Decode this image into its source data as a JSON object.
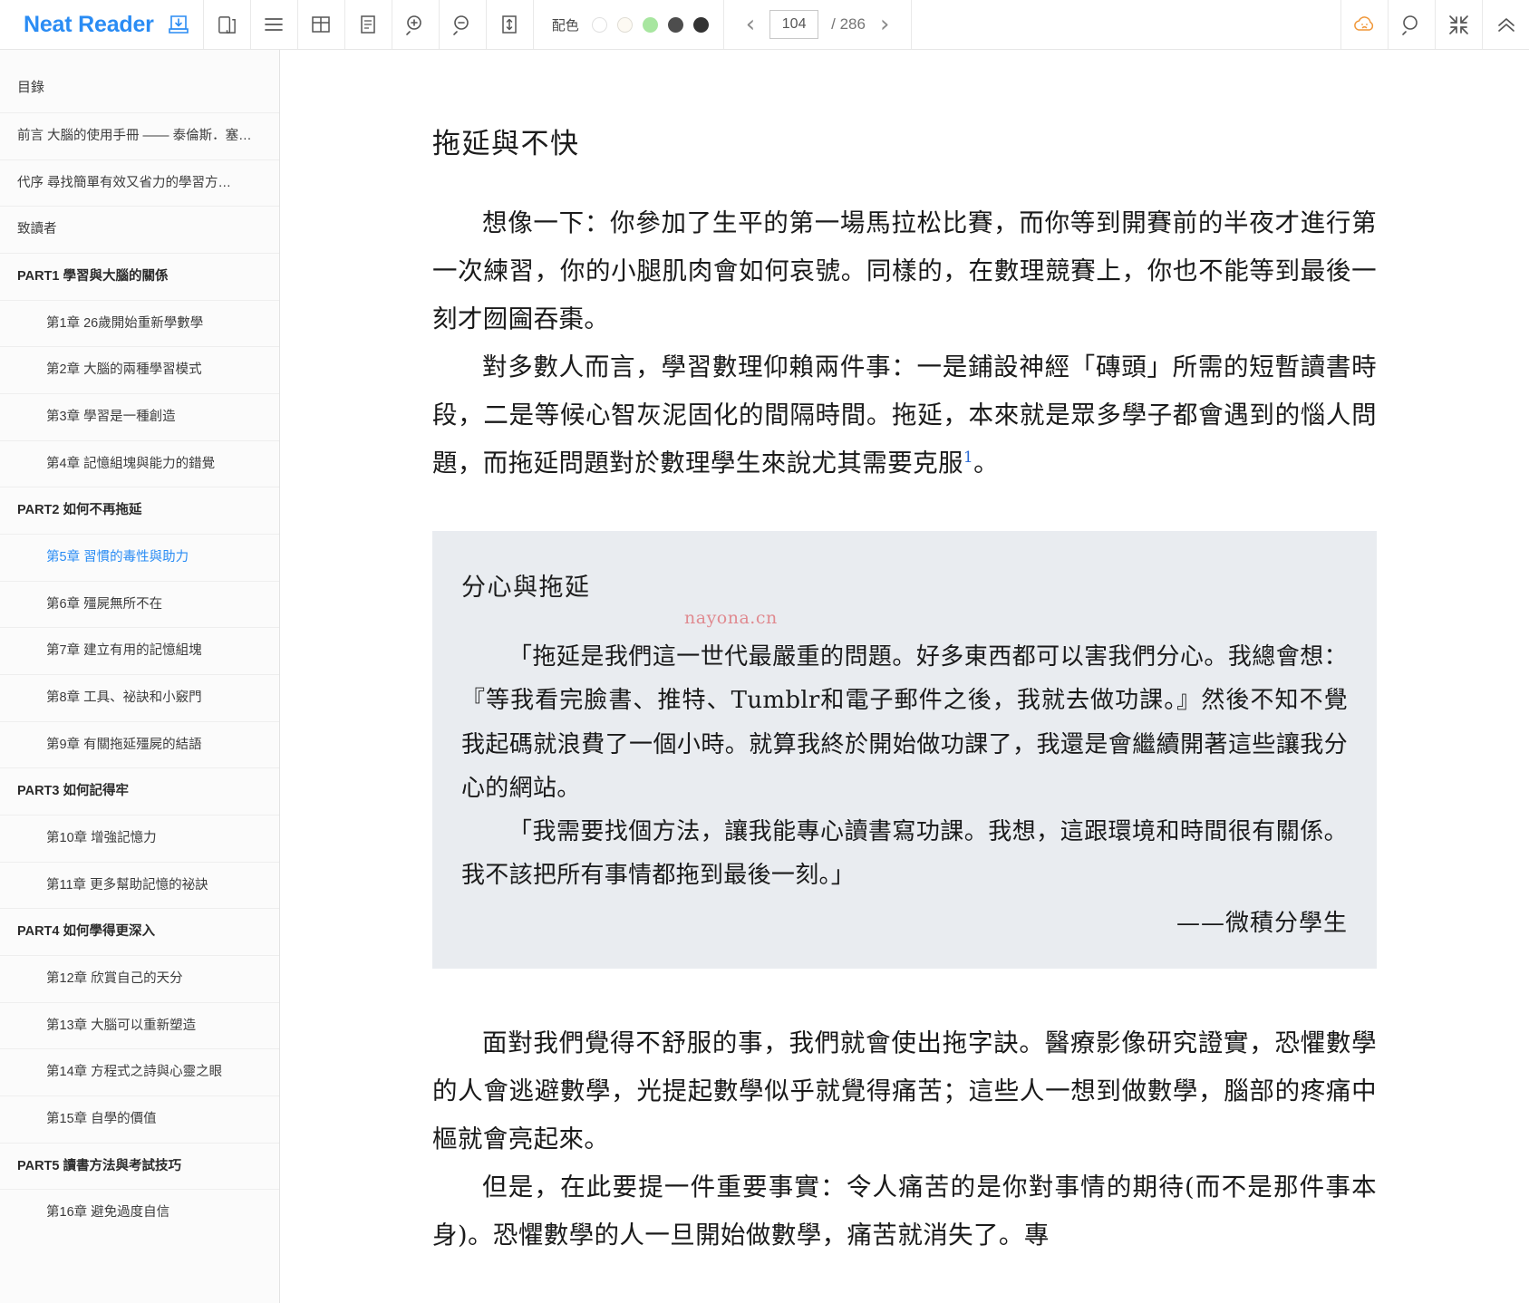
{
  "app": {
    "brand": "Neat Reader",
    "icons": {
      "logo_save": "book-save-icon",
      "copy": "copy-pages-icon",
      "list": "list-view-icon",
      "grid": "grid-view-icon",
      "single": "single-page-icon",
      "zoom_in": "zoom-in-icon",
      "zoom_out": "zoom-out-icon",
      "fit_height": "fit-height-icon",
      "cloud": "cloud-sync-icon",
      "search": "search-icon",
      "collapse": "collapse-icon",
      "chevron_up": "chevron-up-icon",
      "prev": "chevron-left-icon",
      "next": "chevron-right-icon"
    }
  },
  "toolbar": {
    "palette_label": "配色",
    "swatches": [
      {
        "name": "theme-white",
        "color": "#ffffff",
        "border": "#e0e0e0"
      },
      {
        "name": "theme-sepia",
        "color": "#fdfaf3",
        "border": "#e0ddd5"
      },
      {
        "name": "theme-green",
        "color": "#a8e6a0",
        "border": "#a8e6a0"
      },
      {
        "name": "theme-dark-gray",
        "color": "#4d4d4d",
        "border": "#4d4d4d"
      },
      {
        "name": "theme-black",
        "color": "#333333",
        "border": "#333333"
      }
    ],
    "pager": {
      "current": "104",
      "total": "/ 286",
      "prev_glyph": "‹",
      "next_glyph": "›"
    }
  },
  "sidebar": {
    "heading": "目錄",
    "items": [
      {
        "label": "前言  大腦的使用手冊 —— 泰倫斯．塞…",
        "type": "front",
        "active": false
      },
      {
        "label": "代序  尋找簡單有效又省力的學習方…",
        "type": "front",
        "active": false
      },
      {
        "label": "致讀者",
        "type": "front",
        "active": false
      },
      {
        "label": "PART1  學習與大腦的關係",
        "type": "part",
        "active": false
      },
      {
        "label": "第1章  26歲開始重新學數學",
        "type": "chapter",
        "active": false
      },
      {
        "label": "第2章  大腦的兩種學習模式",
        "type": "chapter",
        "active": false
      },
      {
        "label": "第3章  學習是一種創造",
        "type": "chapter",
        "active": false
      },
      {
        "label": "第4章  記憶組塊與能力的錯覺",
        "type": "chapter",
        "active": false
      },
      {
        "label": "PART2  如何不再拖延",
        "type": "part",
        "active": false
      },
      {
        "label": "第5章  習慣的毒性與助力",
        "type": "chapter",
        "active": true
      },
      {
        "label": "第6章  殭屍無所不在",
        "type": "chapter",
        "active": false
      },
      {
        "label": "第7章  建立有用的記憶組塊",
        "type": "chapter",
        "active": false
      },
      {
        "label": "第8章  工具、祕訣和小竅門",
        "type": "chapter",
        "active": false
      },
      {
        "label": "第9章  有關拖延殭屍的結語",
        "type": "chapter",
        "active": false
      },
      {
        "label": "PART3  如何記得牢",
        "type": "part",
        "active": false
      },
      {
        "label": "第10章  增強記憶力",
        "type": "chapter",
        "active": false
      },
      {
        "label": "第11章  更多幫助記憶的祕訣",
        "type": "chapter",
        "active": false
      },
      {
        "label": "PART4  如何學得更深入",
        "type": "part",
        "active": false
      },
      {
        "label": "第12章  欣賞自己的天分",
        "type": "chapter",
        "active": false
      },
      {
        "label": "第13章  大腦可以重新塑造",
        "type": "chapter",
        "active": false
      },
      {
        "label": "第14章  方程式之詩與心靈之眼",
        "type": "chapter",
        "active": false
      },
      {
        "label": "第15章  自學的價值",
        "type": "chapter",
        "active": false
      },
      {
        "label": "PART5  讀書方法與考試技巧",
        "type": "part",
        "active": false
      },
      {
        "label": "第16章  避免過度自信",
        "type": "chapter",
        "active": false
      }
    ]
  },
  "content": {
    "title": "拖延與不快",
    "paragraph1": "想像一下：你參加了生平的第一場馬拉松比賽，而你等到開賽前的半夜才進行第一次練習，你的小腿肌肉會如何哀號。同樣的，在數理競賽上，你也不能等到最後一刻才囫圇吞棗。",
    "paragraph2_before": "對多數人而言，學習數理仰賴兩件事：一是鋪設神經「磚頭」所需的短暫讀書時段，二是等候心智灰泥固化的間隔時間。拖延，本來就是眾多學子都會遇到的惱人問題，而拖延問題對於數理學生來說尤其需要克服",
    "footnote_marker": "1",
    "paragraph2_after": "。",
    "quotebox": {
      "title": "分心與拖延",
      "watermark": "nayona.cn",
      "para1": "「拖延是我們這一世代最嚴重的問題。好多東西都可以害我們分心。我總會想：『等我看完臉書、推特、Tumblr和電子郵件之後，我就去做功課。』然後不知不覺我起碼就浪費了一個小時。就算我終於開始做功課了，我還是會繼續開著這些讓我分心的網站。",
      "para2": "「我需要找個方法，讓我能專心讀書寫功課。我想，這跟環境和時間很有關係。我不該把所有事情都拖到最後一刻。」",
      "attribution": "——微積分學生"
    },
    "paragraph3": "面對我們覺得不舒服的事，我們就會使出拖字訣。醫療影像研究證實，恐懼數學的人會逃避數學，光提起數學似乎就覺得痛苦；這些人一想到做數學，腦部的疼痛中樞就會亮起來。",
    "paragraph4": "但是，在此要提一件重要事實：令人痛苦的是你對事情的期待(而不是那件事本身)。恐懼數學的人一旦開始做數學，痛苦就消失了。專"
  }
}
